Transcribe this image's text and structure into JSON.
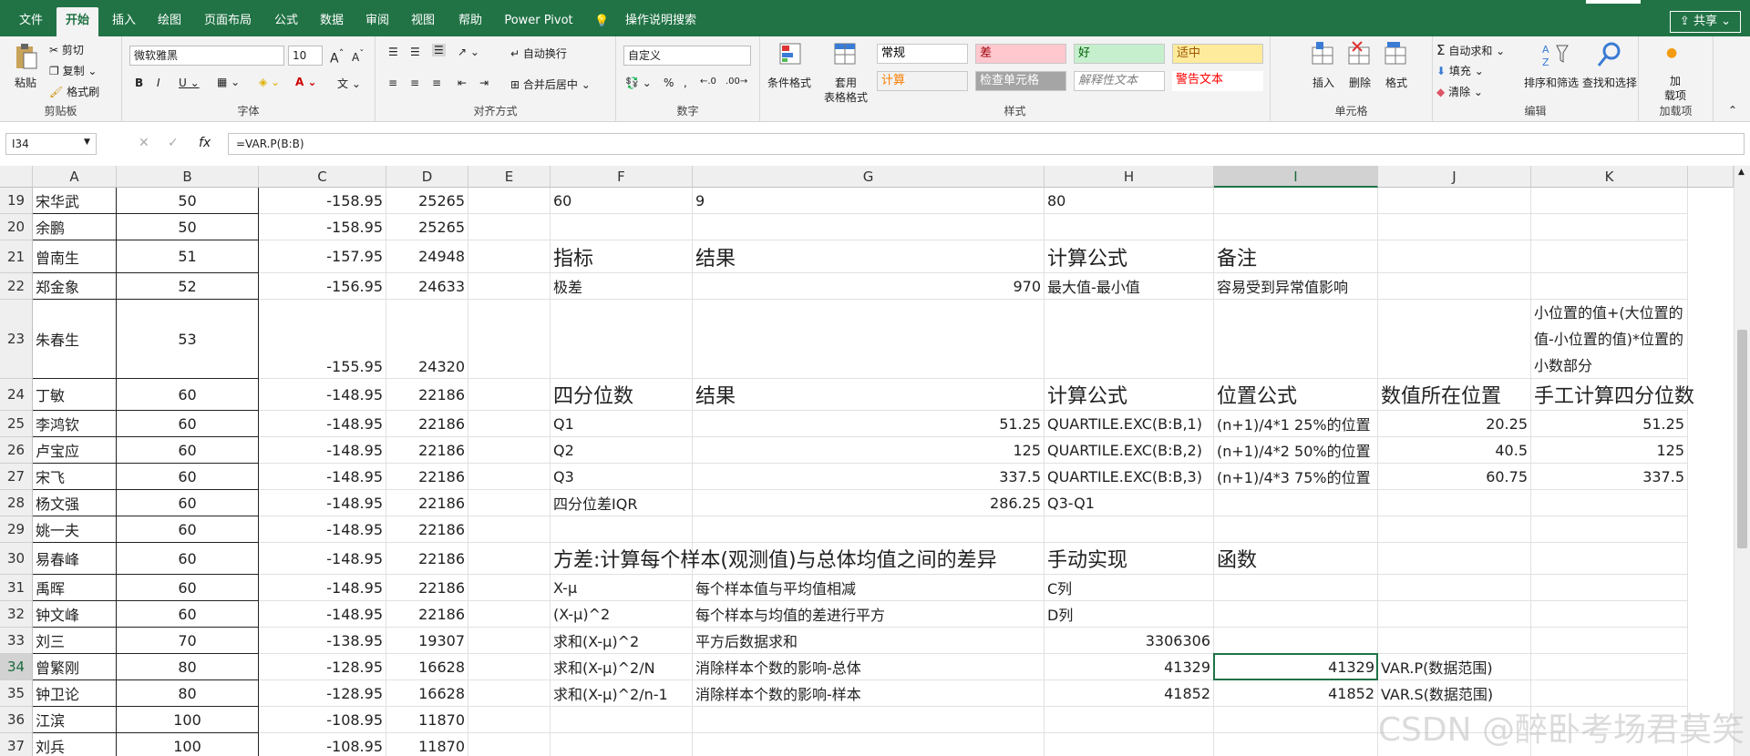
{
  "tabs": [
    "文件",
    "开始",
    "插入",
    "绘图",
    "页面布局",
    "公式",
    "数据",
    "审阅",
    "视图",
    "帮助",
    "Power Pivot",
    "操作说明搜索"
  ],
  "share_label": "共享",
  "ribbon": {
    "clipboard": {
      "paste": "粘贴",
      "cut": "剪切",
      "copy": "复制",
      "format_painter": "格式刷",
      "label": "剪贴板"
    },
    "font": {
      "name": "微软雅黑",
      "size": "10",
      "label": "字体"
    },
    "alignment": {
      "wrap": "自动换行",
      "merge": "合并后居中",
      "label": "对齐方式"
    },
    "number": {
      "format": "自定义",
      "label": "数字"
    },
    "styles": {
      "cond_format": "条件格式",
      "table_format_1": "套用",
      "table_format_2": "表格格式",
      "cells": [
        {
          "text": "常规",
          "bg": "#ffffff",
          "fg": "#000000"
        },
        {
          "text": "差",
          "bg": "#ffc7ce",
          "fg": "#9c0006"
        },
        {
          "text": "好",
          "bg": "#c6efce",
          "fg": "#006100"
        },
        {
          "text": "适中",
          "bg": "#ffeb9c",
          "fg": "#9c5700"
        },
        {
          "text": "计算",
          "bg": "#f2f2f2",
          "fg": "#fa7d00"
        },
        {
          "text": "检查单元格",
          "bg": "#a5a5a5",
          "fg": "#ffffff"
        },
        {
          "text": "解释性文本",
          "bg": "#ffffff",
          "fg": "#7f7f7f"
        },
        {
          "text": "警告文本",
          "bg": "#ffffff",
          "fg": "#ff0000"
        }
      ],
      "label": "样式"
    },
    "cells": {
      "insert": "插入",
      "delete": "删除",
      "format": "格式",
      "label": "单元格"
    },
    "editing": {
      "autosum": "自动求和",
      "fill": "填充",
      "clear": "清除",
      "sort": "排序和筛选",
      "find": "查找和选择",
      "label": "编辑"
    },
    "addins": {
      "load_1": "加",
      "load_2": "载项",
      "label": "加载项"
    }
  },
  "formula_bar": {
    "name_box": "I34",
    "formula": "=VAR.P(B:B)"
  },
  "columns": [
    "A",
    "B",
    "C",
    "D",
    "E",
    "F",
    "G",
    "H",
    "I",
    "J",
    "K"
  ],
  "selected_col": "I",
  "selected_row": "34",
  "rows": [
    {
      "n": "19",
      "h": 29,
      "cells": {
        "A": "宋华武",
        "B": "50",
        "C": "-158.95",
        "D": "25265",
        "F": "60",
        "G": "9",
        "H": "80"
      }
    },
    {
      "n": "20",
      "h": 29,
      "cells": {
        "A": "余鹏",
        "B": "50",
        "C": "-158.95",
        "D": "25265"
      }
    },
    {
      "n": "21",
      "h": 36,
      "cells": {
        "A": "曾南生",
        "B": "51",
        "C": "-157.95",
        "D": "24948",
        "F": "指标",
        "G": "结果",
        "H": "计算公式",
        "I": "备注"
      }
    },
    {
      "n": "22",
      "h": 29,
      "cells": {
        "A": "郑金象",
        "B": "52",
        "C": "-156.95",
        "D": "24633",
        "F": "极差",
        "G": "970",
        "H": "最大值-最小值",
        "I": "容易受到异常值影响"
      }
    },
    {
      "n": "23",
      "h": 87,
      "cells": {
        "A": "朱春生",
        "B": "53",
        "C": "-155.95",
        "D": "24320",
        "K": "小位置的值+(大位置的值-小位置的值)*位置的小数部分"
      }
    },
    {
      "n": "24",
      "h": 35,
      "cells": {
        "A": "丁敏",
        "B": "60",
        "C": "-148.95",
        "D": "22186",
        "F": "四分位数",
        "G": "结果",
        "H": "计算公式",
        "I": "位置公式",
        "J": "数值所在位置",
        "K": "手工计算四分位数"
      }
    },
    {
      "n": "25",
      "h": 29,
      "cells": {
        "A": "李鸿钦",
        "B": "60",
        "C": "-148.95",
        "D": "22186",
        "F": "Q1",
        "G": "51.25",
        "H": "QUARTILE.EXC(B:B,1)",
        "I": "(n+1)/4*1  25%的位置",
        "J": "20.25",
        "K": "51.25"
      }
    },
    {
      "n": "26",
      "h": 29,
      "cells": {
        "A": "卢宝应",
        "B": "60",
        "C": "-148.95",
        "D": "22186",
        "F": "Q2",
        "G": "125",
        "H": "QUARTILE.EXC(B:B,2)",
        "I": "(n+1)/4*2  50%的位置",
        "J": "40.5",
        "K": "125"
      }
    },
    {
      "n": "27",
      "h": 29,
      "cells": {
        "A": "宋飞",
        "B": "60",
        "C": "-148.95",
        "D": "22186",
        "F": "Q3",
        "G": "337.5",
        "H": "QUARTILE.EXC(B:B,3)",
        "I": "(n+1)/4*3  75%的位置",
        "J": "60.75",
        "K": "337.5"
      }
    },
    {
      "n": "28",
      "h": 29,
      "cells": {
        "A": "杨文强",
        "B": "60",
        "C": "-148.95",
        "D": "22186",
        "F": "四分位差IQR",
        "G": "286.25",
        "H": "Q3-Q1"
      }
    },
    {
      "n": "29",
      "h": 29,
      "cells": {
        "A": "姚一夫",
        "B": "60",
        "C": "-148.95",
        "D": "22186"
      }
    },
    {
      "n": "30",
      "h": 35,
      "cells": {
        "A": "易春峰",
        "B": "60",
        "C": "-148.95",
        "D": "22186",
        "F": "方差:计算每个样本(观测值)与总体均值之间的差异",
        "H": "手动实现",
        "I": "函数"
      }
    },
    {
      "n": "31",
      "h": 29,
      "cells": {
        "A": "禹晖",
        "B": "60",
        "C": "-148.95",
        "D": "22186",
        "F": "X-μ",
        "G": "每个样本值与平均值相减",
        "H": "C列"
      }
    },
    {
      "n": "32",
      "h": 29,
      "cells": {
        "A": "钟文峰",
        "B": "60",
        "C": "-148.95",
        "D": "22186",
        "F": "(X-μ)^2",
        "G": "每个样本与均值的差进行平方",
        "H": "D列"
      }
    },
    {
      "n": "33",
      "h": 29,
      "cells": {
        "A": "刘三",
        "B": "70",
        "C": "-138.95",
        "D": "19307",
        "F": "求和(X-μ)^2",
        "G": "平方后数据求和",
        "H": "3306306"
      }
    },
    {
      "n": "34",
      "h": 29,
      "cells": {
        "A": "曾繁刚",
        "B": "80",
        "C": "-128.95",
        "D": "16628",
        "F": "求和(X-μ)^2/N",
        "G": "消除样本个数的影响-总体",
        "H": "41329",
        "I": "41329",
        "J": "VAR.P(数据范围)"
      }
    },
    {
      "n": "35",
      "h": 29,
      "cells": {
        "A": "钟卫论",
        "B": "80",
        "C": "-128.95",
        "D": "16628",
        "F": "求和(X-μ)^2/n-1",
        "G": "消除样本个数的影响-样本",
        "H": "41852",
        "I": "41852",
        "J": "VAR.S(数据范围)"
      }
    },
    {
      "n": "36",
      "h": 29,
      "cells": {
        "A": "江滨",
        "B": "100",
        "C": "-108.95",
        "D": "11870"
      }
    },
    {
      "n": "37",
      "h": 29,
      "cells": {
        "A": "刘兵",
        "B": "100",
        "C": "-108.95",
        "D": "11870"
      }
    }
  ],
  "watermark": "CSDN @醉卧考场君莫笑"
}
